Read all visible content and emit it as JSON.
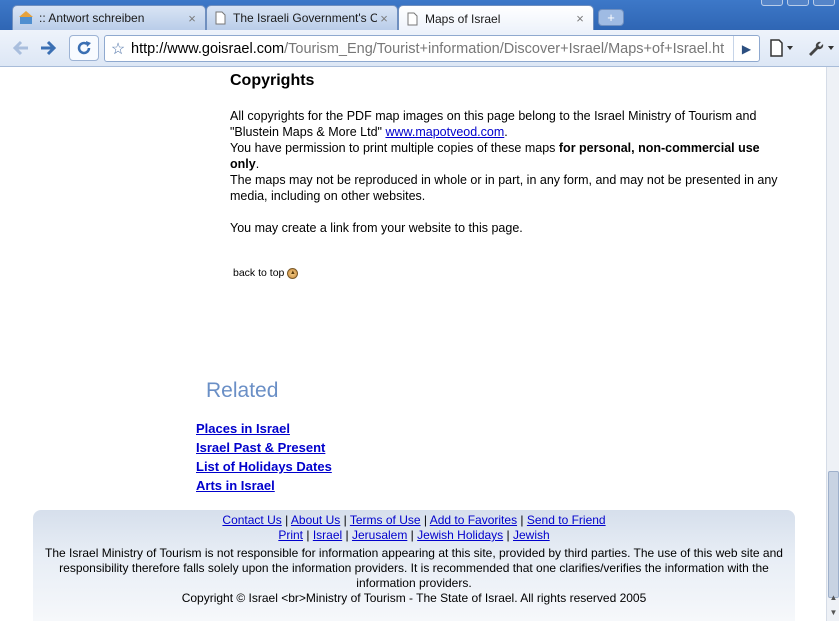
{
  "browser": {
    "tabs": [
      {
        "title": ":: Antwort schreiben",
        "active": false
      },
      {
        "title": "The Israeli Government's O...",
        "active": false
      },
      {
        "title": "Maps of Israel",
        "active": true
      }
    ],
    "close_glyph": "×",
    "newtab_glyph": "+",
    "url_host": "http://www.goisrael.com",
    "url_path": "/Tourism_Eng/Tourist+information/Discover+Israel/Maps+of+Israel.ht",
    "icons": {
      "back": "arrow-left-icon",
      "forward": "arrow-right-icon",
      "reload": "reload-icon",
      "bookmark": "star-icon",
      "go": "play-icon",
      "page": "page-menu-icon",
      "tools": "wrench-icon"
    },
    "accent": "#3a6fb3"
  },
  "content": {
    "heading": "Copyrights",
    "para1_text": "All copyrights for the PDF map images on this page belong to the Israel Ministry of Tourism and \"Blustein Maps & More Ltd\" ",
    "para1_link": "www.mapotveod.com",
    "para1_end": ".",
    "para2_pre": "You have permission to print multiple copies of these maps ",
    "para2_bold": "for personal, non-commercial use only",
    "para2_end": ".",
    "para3": "The maps may not be reproduced in whole or in part, in any form, and may not be presented in any media, including on other websites.",
    "para4": "You may create a link from your website to this page.",
    "back_to_top": "back to top"
  },
  "related": {
    "title": "Related",
    "links": [
      "Places in Israel",
      "Israel Past & Present",
      "List of Holidays Dates",
      "Arts in Israel"
    ],
    "link_color": "#0000cc",
    "title_color": "#6a8fc6"
  },
  "footer": {
    "row1": [
      "Contact Us",
      "About Us",
      "Terms of Use",
      "Add to Favorites",
      "Send to Friend"
    ],
    "row2": [
      "Print",
      "Israel",
      "Jerusalem",
      "Jewish Holidays",
      "Jewish"
    ],
    "separator": "|",
    "disclaimer": "The Israel Ministry of Tourism is not responsible for information appearing at this site, provided by third parties. The use of this web site and responsibility therefore falls solely upon the information providers. It is recommended that one clarifies/verifies the information with the information providers.",
    "copyright": "Copyright © Israel <br>Ministry of Tourism - The State of Israel.  All rights reserved 2005"
  }
}
